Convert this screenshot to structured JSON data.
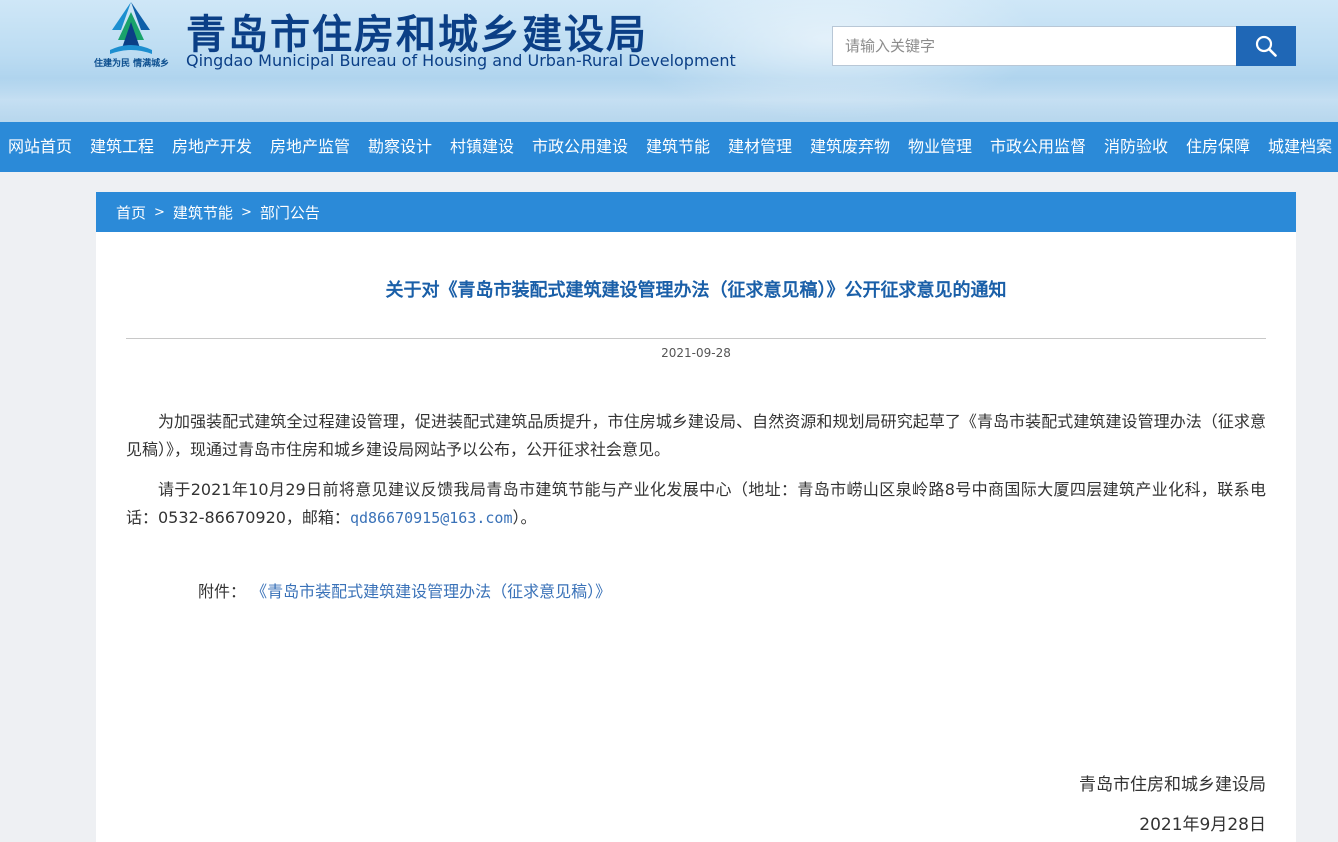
{
  "header": {
    "title_cn": "青岛市住房和城乡建设局",
    "title_en": "Qingdao Municipal Bureau of Housing and Urban-Rural Development",
    "slogan": "住建为民 情满城乡",
    "search_placeholder": "请输入关键字"
  },
  "nav": {
    "items": [
      {
        "label": "网站首页"
      },
      {
        "label": "建筑工程"
      },
      {
        "label": "房地产开发"
      },
      {
        "label": "房地产监管"
      },
      {
        "label": "勘察设计"
      },
      {
        "label": "村镇建设"
      },
      {
        "label": "市政公用建设"
      },
      {
        "label": "建筑节能"
      },
      {
        "label": "建材管理"
      },
      {
        "label": "建筑废弃物"
      },
      {
        "label": "物业管理"
      },
      {
        "label": "市政公用监督"
      },
      {
        "label": "消防验收"
      },
      {
        "label": "住房保障"
      },
      {
        "label": "城建档案"
      }
    ]
  },
  "breadcrumb": {
    "items": [
      "首页",
      "建筑节能",
      "部门公告"
    ],
    "separator": ">"
  },
  "article": {
    "title": "关于对《青岛市装配式建筑建设管理办法（征求意见稿）》公开征求意见的通知",
    "date": "2021-09-28",
    "para1": "为加强装配式建筑全过程建设管理，促进装配式建筑品质提升，市住房城乡建设局、自然资源和规划局研究起草了《青岛市装配式建筑建设管理办法（征求意见稿）》，现通过青岛市住房和城乡建设局网站予以公布，公开征求社会意见。",
    "para2_before": "请于2021年10月29日前将意见建议反馈我局青岛市建筑节能与产业化发展中心（地址：青岛市崂山区泉岭路8号中商国际大厦四层建筑产业化科，联系电话：0532-86670920，邮箱：",
    "email": "qd86670915@163.com",
    "para2_after": "）。",
    "attach_label": "附件：",
    "attach_link": "《青岛市装配式建筑建设管理办法（征求意见稿）》",
    "sign_org": "青岛市住房和城乡建设局",
    "sign_date": "2021年9月28日"
  },
  "colors": {
    "nav_bg": "#2b8ad8",
    "title_blue": "#1a5fa8",
    "link_blue": "#3a72b8",
    "brand_dark": "#0b3f86"
  }
}
